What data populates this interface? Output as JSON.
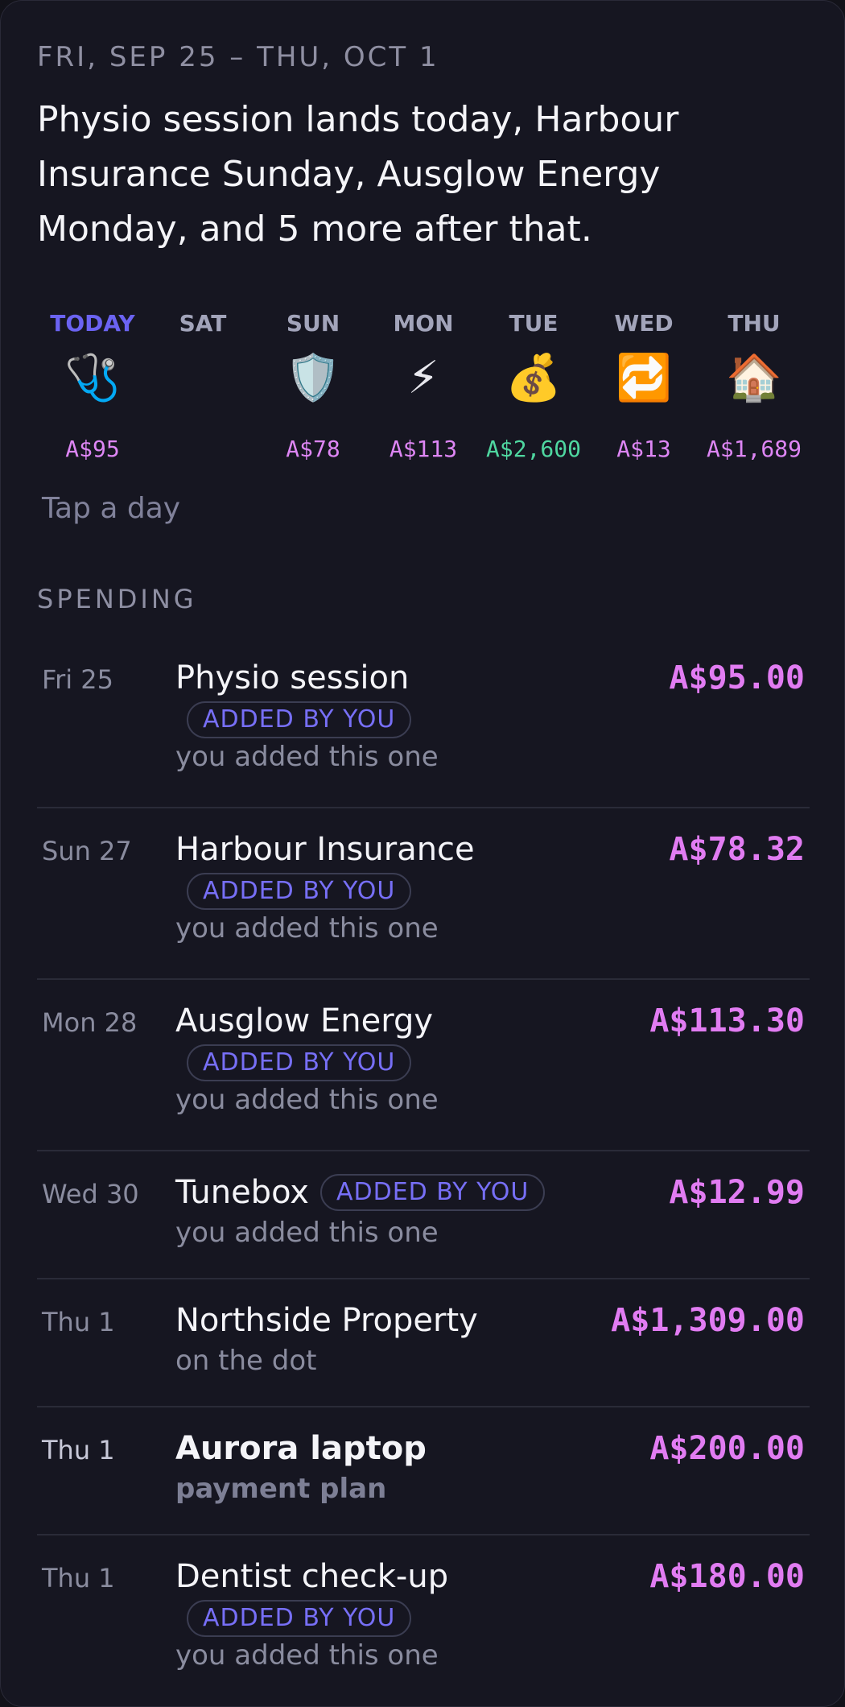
{
  "range": "FRI, SEP 25 – THU, OCT 1",
  "summary": "Physio session lands today, Harbour Insurance Sunday, Ausglow Energy Monday, and 5 more after that.",
  "days": [
    {
      "label": "TODAY",
      "icon": "🩺",
      "icon_name": "stethoscope-icon",
      "amount": "A$95"
    },
    {
      "label": "SAT",
      "icon": "",
      "icon_name": "",
      "amount": ""
    },
    {
      "label": "SUN",
      "icon": "🛡️",
      "icon_name": "shield-icon",
      "amount": "A$78"
    },
    {
      "label": "MON",
      "icon": "⚡",
      "icon_name": "lightning-icon",
      "amount": "A$113"
    },
    {
      "label": "TUE",
      "icon": "💰",
      "icon_name": "money-bag-icon",
      "amount": "A$2,600"
    },
    {
      "label": "WED",
      "icon": "🔁",
      "icon_name": "repeat-icon",
      "amount": "A$13"
    },
    {
      "label": "THU",
      "icon": "🏠",
      "icon_name": "house-icon",
      "amount": "A$1,689"
    }
  ],
  "hint": "Tap a day",
  "section_title": "SPENDING",
  "badge_label": "ADDED BY YOU",
  "items": [
    {
      "date": "Fri 25",
      "name": "Physio session",
      "badge": "ADDED BY YOU",
      "note": "you added this one",
      "amount": "A$95.00"
    },
    {
      "date": "Sun 27",
      "name": "Harbour Insurance",
      "badge": "ADDED BY YOU",
      "note": "you added this one",
      "amount": "A$78.32"
    },
    {
      "date": "Mon 28",
      "name": "Ausglow Energy",
      "badge": "ADDED BY YOU",
      "note": "you added this one",
      "amount": "A$113.30"
    },
    {
      "date": "Wed 30",
      "name": "Tunebox",
      "badge": "ADDED BY YOU",
      "note": "you added this one",
      "amount": "A$12.99"
    },
    {
      "date": "Thu 1",
      "name": "Northside Property",
      "badge": "",
      "note": "on the dot",
      "amount": "A$1,309.00"
    },
    {
      "date": "Thu 1",
      "name": "Aurora laptop",
      "badge": "",
      "note": "payment plan",
      "amount": "A$200.00"
    },
    {
      "date": "Thu 1",
      "name": "Dentist check-up",
      "badge": "ADDED BY YOU",
      "note": "you added this one",
      "amount": "A$180.00"
    }
  ],
  "colors": {
    "accent": "#6b63f2",
    "amount": "#e17cf2",
    "positive": "#4fd7a0",
    "background": "#161621"
  }
}
